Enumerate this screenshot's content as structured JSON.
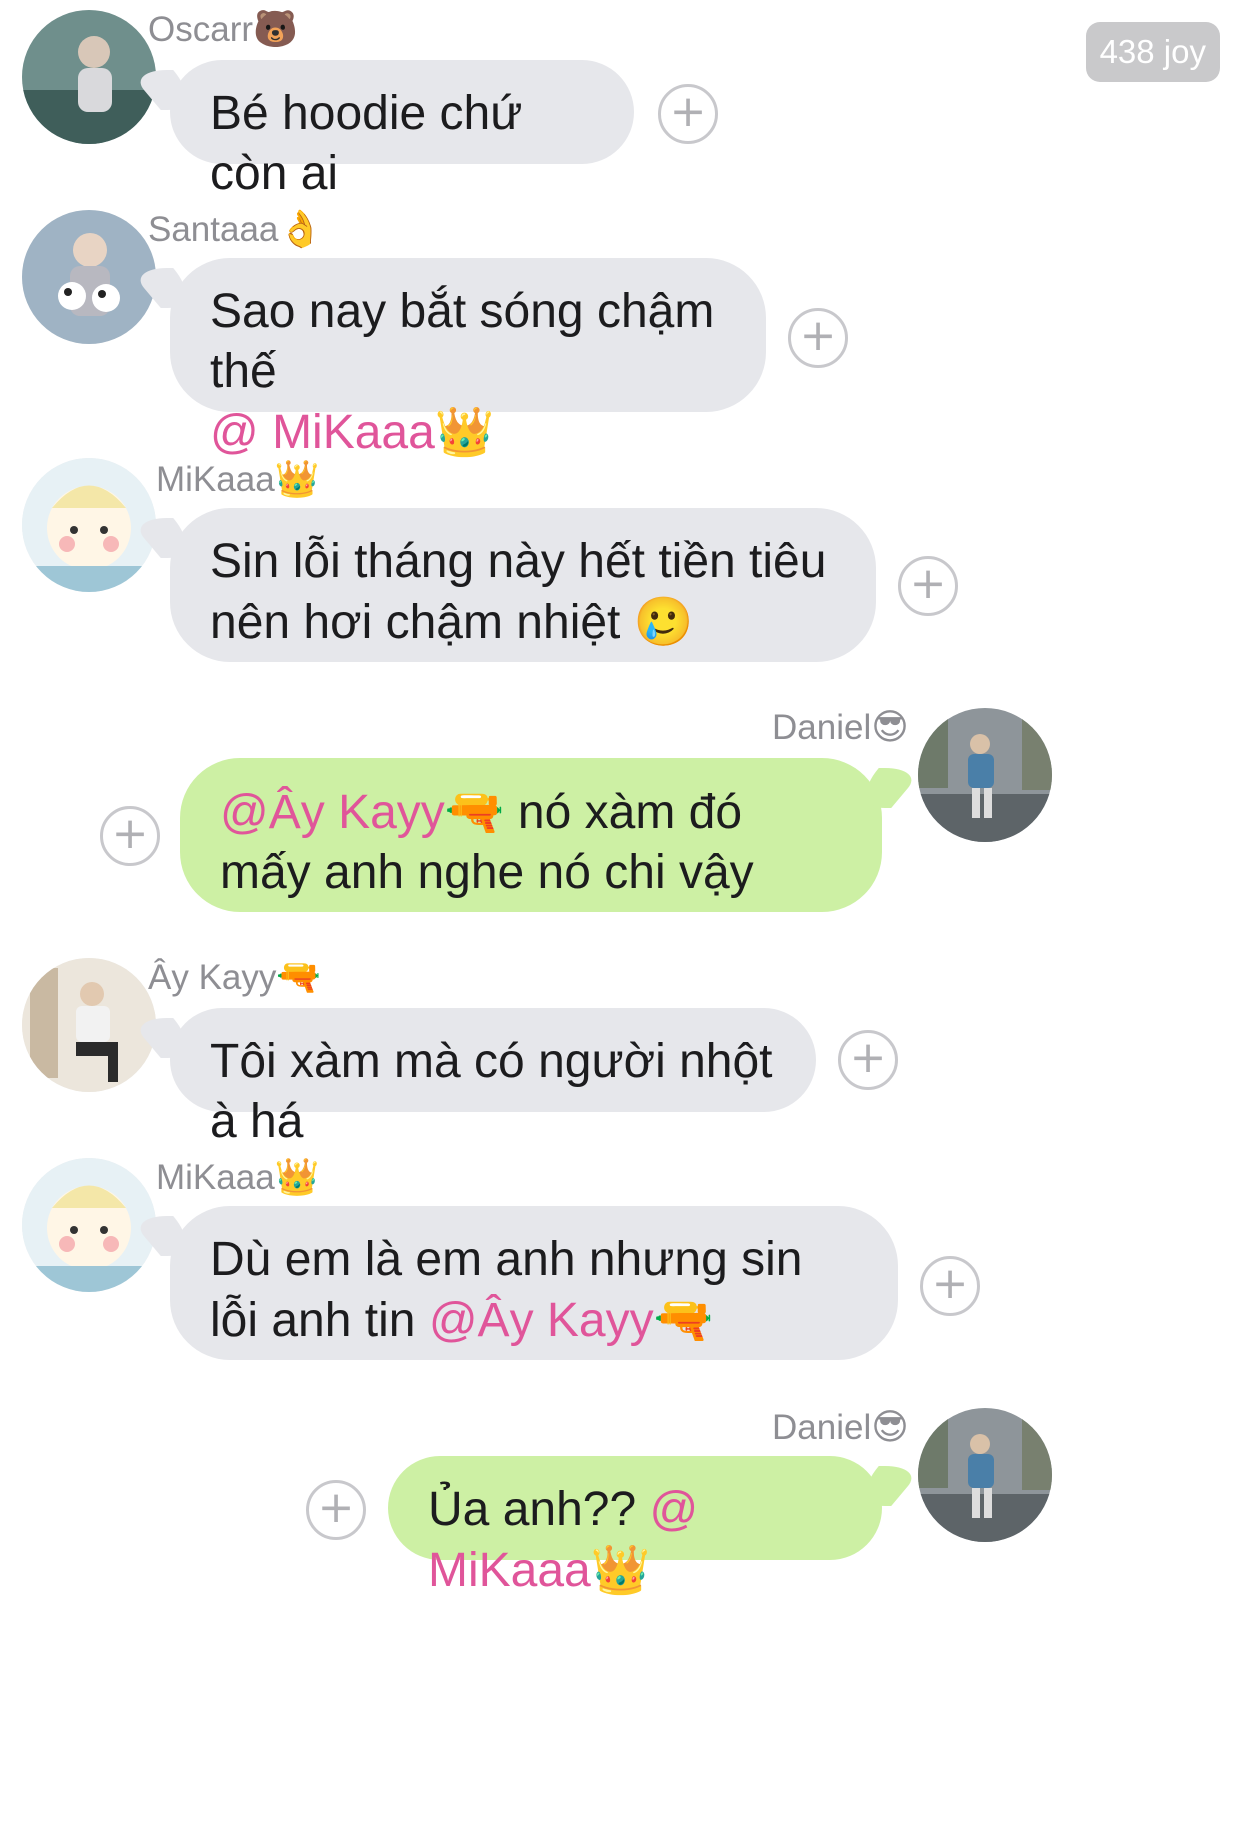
{
  "counter": "438 joy",
  "react_symbol": "+",
  "messages": [
    {
      "sender": "Oscarr",
      "sender_emoji": "🐻",
      "text": "Bé hoodie chứ còn ai"
    },
    {
      "sender": "Santaaa",
      "sender_emoji": "👌",
      "text": "Sao nay bắt sóng chậm thế",
      "mention": "@ MiKaaa",
      "mention_emoji": "👑"
    },
    {
      "sender": "MiKaaa",
      "sender_emoji": "👑",
      "text": "Sin lỗi tháng này hết tiền tiêu nên hơi chậm nhiệt",
      "emoji": "🥲"
    },
    {
      "sender": "Daniel",
      "sender_emoji": "😎",
      "mention": "@Ây Kayy",
      "mention_emoji": "🔫",
      "text": "nó xàm đó mấy anh nghe nó chi vậy"
    },
    {
      "sender": "Ây Kayy",
      "sender_emoji": "🔫",
      "text": "Tôi xàm mà có người nhột à há"
    },
    {
      "sender": "MiKaaa",
      "sender_emoji": "👑",
      "text": "Dù em là em anh nhưng sin lỗi anh tin",
      "mention": "@Ây Kayy",
      "mention_emoji": "🔫"
    },
    {
      "sender": "Daniel",
      "sender_emoji": "😎",
      "text": "Ủa anh??",
      "mention": "@ MiKaaa",
      "mention_emoji": "👑"
    }
  ]
}
